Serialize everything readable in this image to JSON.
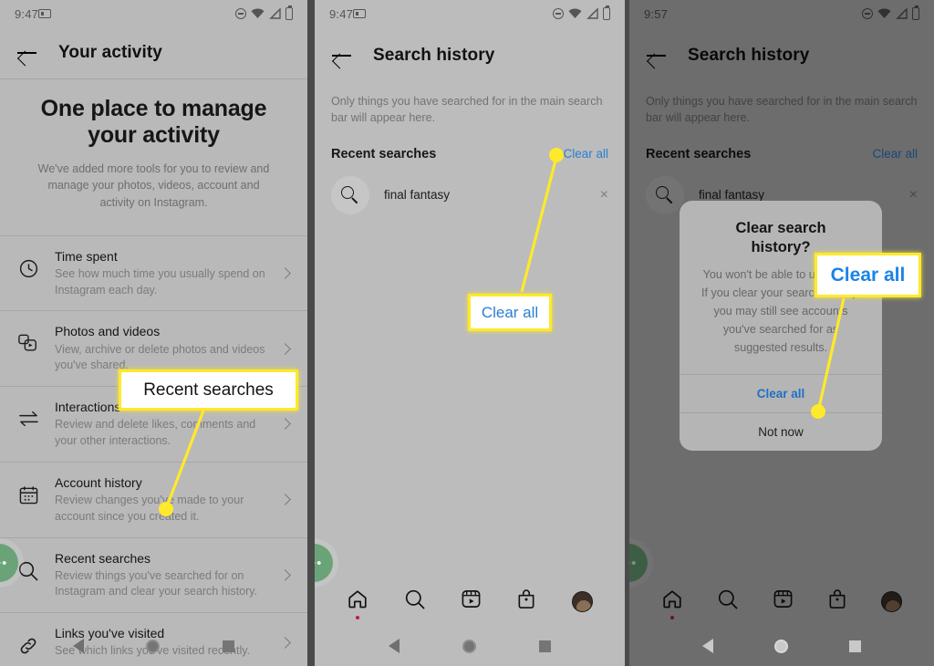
{
  "panels": [
    {
      "id": "your-activity",
      "statusbar": {
        "time": "9:47",
        "icons": [
          "camera-icon",
          "do-not-disturb-icon",
          "wifi-icon",
          "signal-icon",
          "battery-icon"
        ]
      },
      "appbar": {
        "title": "Your activity",
        "back_label": "Back"
      },
      "hero": {
        "title": "One place to manage your activity",
        "subtitle": "We've added more tools for you to review and manage your photos, videos, account and activity on Instagram."
      },
      "rows": [
        {
          "icon": "clock-icon",
          "title": "Time spent",
          "desc": "See how much time you usually spend on Instagram each day."
        },
        {
          "icon": "photos-videos-icon",
          "title": "Photos and videos",
          "desc": "View, archive or delete photos and videos you've shared."
        },
        {
          "icon": "interactions-icon",
          "title": "Interactions",
          "desc": "Review and delete likes, comments and your other interactions."
        },
        {
          "icon": "calendar-icon",
          "title": "Account history",
          "desc": "Review changes you've made to your account since you created it."
        },
        {
          "icon": "search-icon",
          "title": "Recent searches",
          "desc": "Review things you've searched for on Instagram and clear your search history."
        },
        {
          "icon": "link-icon",
          "title": "Links you've visited",
          "desc": "See which links you've visited recently."
        }
      ],
      "fab_label": "•••"
    },
    {
      "id": "search-history-light",
      "statusbar": {
        "time": "9:47"
      },
      "appbar": {
        "title": "Search history"
      },
      "note": "Only things you have searched for in the main search bar will appear here.",
      "section": {
        "title": "Recent searches",
        "action": "Clear all"
      },
      "searches": [
        {
          "term": "final fantasy",
          "remove_label": "×"
        }
      ],
      "bottom_nav": [
        "home-icon",
        "search-icon",
        "reels-icon",
        "shop-icon",
        "profile-avatar"
      ],
      "fab_label": "•••"
    },
    {
      "id": "search-history-dialog",
      "statusbar": {
        "time": "9:57"
      },
      "appbar": {
        "title": "Search history"
      },
      "note": "Only things you have searched for in the main search bar will appear here.",
      "section": {
        "title": "Recent searches",
        "action": "Clear all"
      },
      "searches": [
        {
          "term": "final fantasy",
          "remove_label": "×"
        }
      ],
      "dialog": {
        "title": "Clear search history?",
        "body": "You won't be able to undo this. If you clear your search history, you may still see accounts you've searched for as suggested results.",
        "primary": "Clear all",
        "secondary": "Not now"
      },
      "bottom_nav": [
        "home-icon",
        "search-icon",
        "reels-icon",
        "shop-icon",
        "profile-avatar"
      ],
      "fab_label": "•••"
    }
  ],
  "callouts": [
    {
      "id": "callout-recent-searches",
      "text": "Recent searches",
      "color": "#141414"
    },
    {
      "id": "callout-clear-all-list",
      "text": "Clear all",
      "color": "#2a7fd4"
    },
    {
      "id": "callout-clear-all-dialog",
      "text": "Clear all",
      "color": "#1c83e8"
    }
  ],
  "colors": {
    "highlight": "#ffe92b",
    "link": "#2c7fd0",
    "fab": "#6aa378",
    "background": "#4a4a4a"
  }
}
